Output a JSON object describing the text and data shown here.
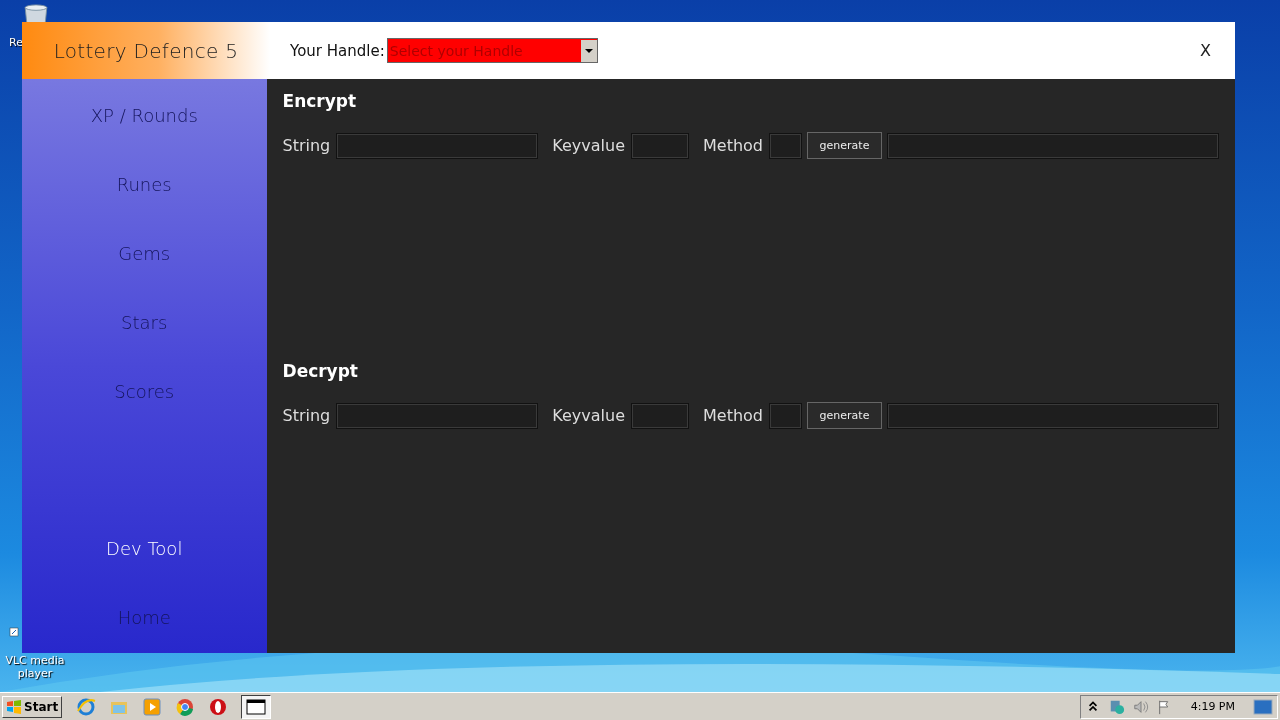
{
  "desktop": {
    "icons": [
      {
        "label": "Re"
      },
      {
        "label": "VLC media player"
      }
    ]
  },
  "window": {
    "title": "Lottery Defence 5",
    "close": "X",
    "handle": {
      "label": "Your Handle:",
      "value": "Select your Handle"
    }
  },
  "sidebar": {
    "items": [
      {
        "label": "XP / Rounds",
        "selected": false
      },
      {
        "label": "Runes",
        "selected": false
      },
      {
        "label": "Gems",
        "selected": false
      },
      {
        "label": "Stars",
        "selected": false
      },
      {
        "label": "Scores",
        "selected": false
      },
      {
        "label": "Dev Tool",
        "selected": true
      },
      {
        "label": "Home",
        "selected": false
      }
    ]
  },
  "sections": [
    {
      "title": "Encrypt",
      "fields": [
        {
          "label": "String",
          "kind": "wide"
        },
        {
          "label": "Keyvalue",
          "kind": "medium"
        },
        {
          "label": "Method",
          "kind": "small"
        }
      ],
      "button": "generate"
    },
    {
      "title": "Decrypt",
      "fields": [
        {
          "label": "String",
          "kind": "wide"
        },
        {
          "label": "Keyvalue",
          "kind": "medium"
        },
        {
          "label": "Method",
          "kind": "small"
        }
      ],
      "button": "generate"
    }
  ],
  "taskbar": {
    "start": "Start",
    "clock": "4:19 PM"
  }
}
